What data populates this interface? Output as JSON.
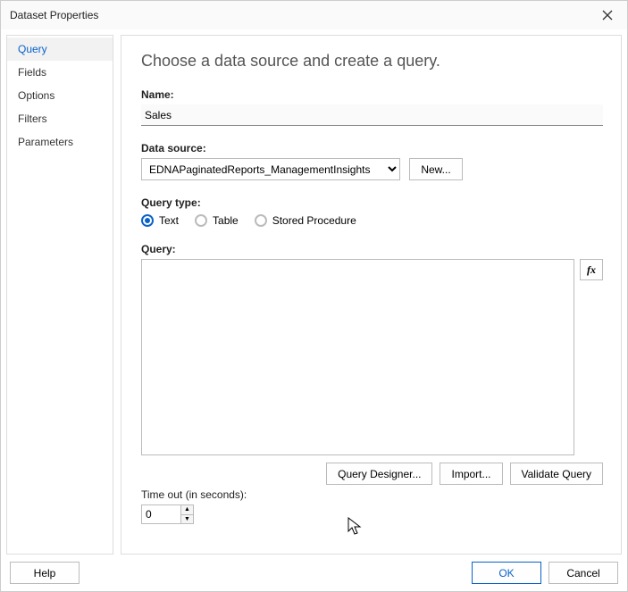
{
  "window": {
    "title": "Dataset Properties"
  },
  "sidebar": {
    "items": [
      {
        "label": "Query",
        "active": true
      },
      {
        "label": "Fields"
      },
      {
        "label": "Options"
      },
      {
        "label": "Filters"
      },
      {
        "label": "Parameters"
      }
    ]
  },
  "main": {
    "heading": "Choose a data source and create a query.",
    "name_label": "Name:",
    "name_value": "Sales",
    "datasource_label": "Data source:",
    "datasource_selected": "EDNAPaginatedReports_ManagementInsights",
    "new_btn": "New...",
    "querytype_label": "Query type:",
    "querytype_options": [
      "Text",
      "Table",
      "Stored Procedure"
    ],
    "querytype_selected": "Text",
    "query_label": "Query:",
    "query_value": "",
    "fx_label": "fx",
    "query_designer_btn": "Query Designer...",
    "import_btn": "Import...",
    "validate_btn": "Validate Query",
    "timeout_label": "Time out (in seconds):",
    "timeout_value": "0"
  },
  "footer": {
    "help": "Help",
    "ok": "OK",
    "cancel": "Cancel"
  }
}
